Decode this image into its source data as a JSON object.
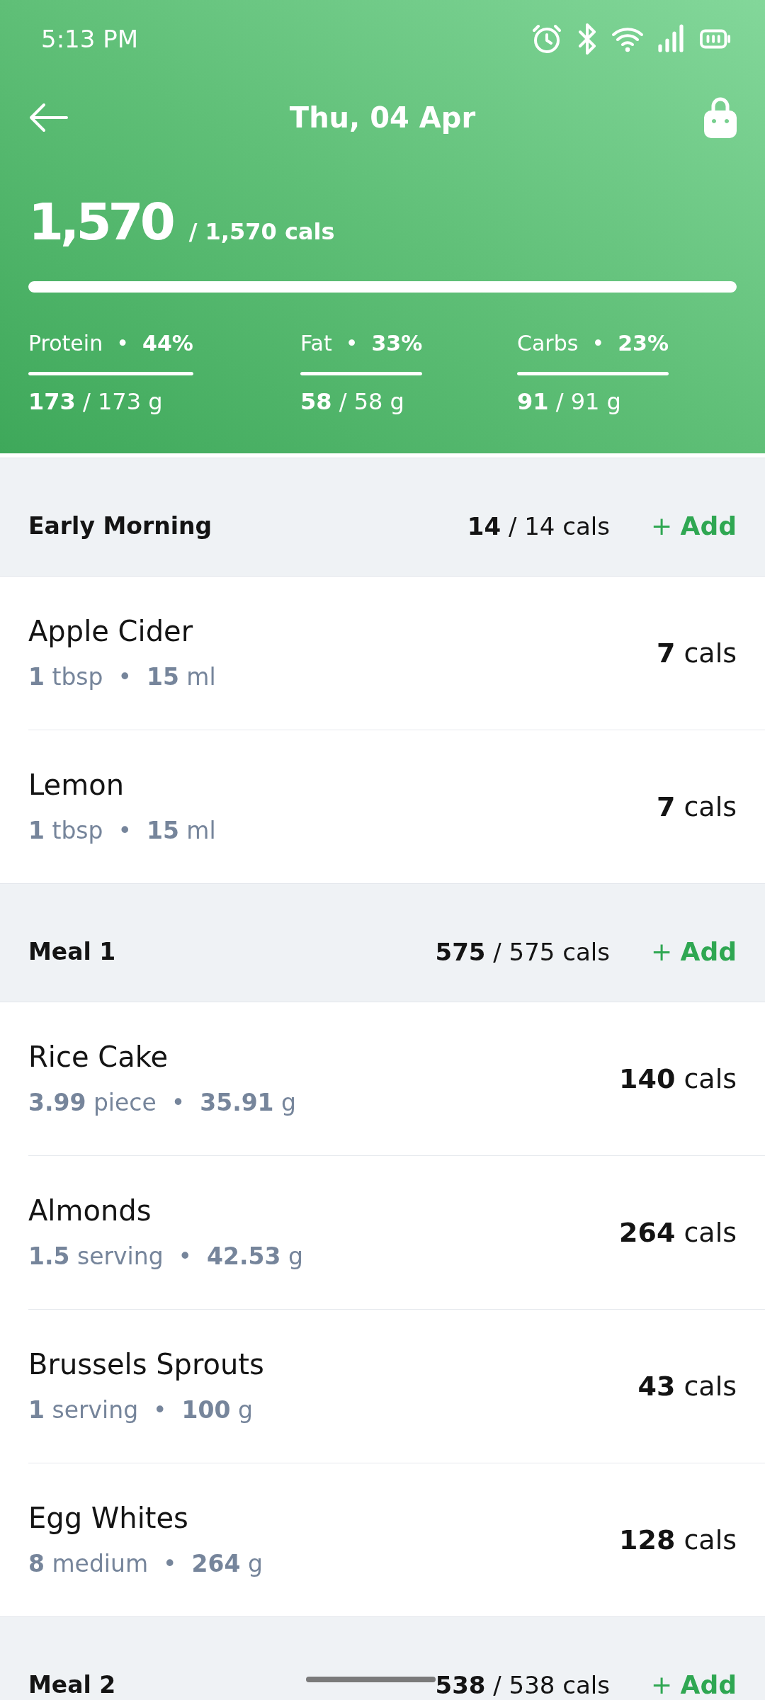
{
  "status_bar": {
    "time": "5:13 PM"
  },
  "header": {
    "title": "Thu, 04 Apr",
    "calories": "1,570",
    "target": "/ 1,570 cals",
    "level": 1,
    "macros": [
      {
        "label": "Protein  •  **44%**",
        "value": "**173** / 173 g",
        "level": 1
      },
      {
        "label": "Fat  •  **33%**",
        "value": "**58** / 58 g",
        "level": 1
      },
      {
        "label": "Carbs  •  **23%**",
        "value": "**91** / 91 g",
        "level": 1
      }
    ]
  },
  "meals": [
    {
      "name": "Early Morning",
      "calories": "**14** / 14 cals",
      "add": "+ **Add**",
      "foods": [
        {
          "name": "Apple Cider",
          "portion": "**1** tbsp  •  **15** ml",
          "calories": "**7** cals"
        },
        {
          "name": "Lemon",
          "portion": "**1** tbsp  •  **15** ml",
          "calories": "**7** cals"
        }
      ]
    },
    {
      "name": "Meal 1",
      "calories": "**575** / 575 cals",
      "add": "+ **Add**",
      "foods": [
        {
          "name": "Rice Cake",
          "portion": "**3.99** piece  •  **35.91** g",
          "calories": "**140** cals"
        },
        {
          "name": "Almonds",
          "portion": "**1.5** serving  •  **42.53** g",
          "calories": "**264** cals"
        },
        {
          "name": "Brussels Sprouts",
          "portion": "**1** serving  •  **100** g",
          "calories": "**43** cals"
        },
        {
          "name": "Egg Whites",
          "portion": "**8** medium  •  **264** g",
          "calories": "**128** cals"
        }
      ]
    },
    {
      "name": "Meal 2",
      "calories": "**538** / 538 cals",
      "add": "+ **Add**"
    }
  ]
}
